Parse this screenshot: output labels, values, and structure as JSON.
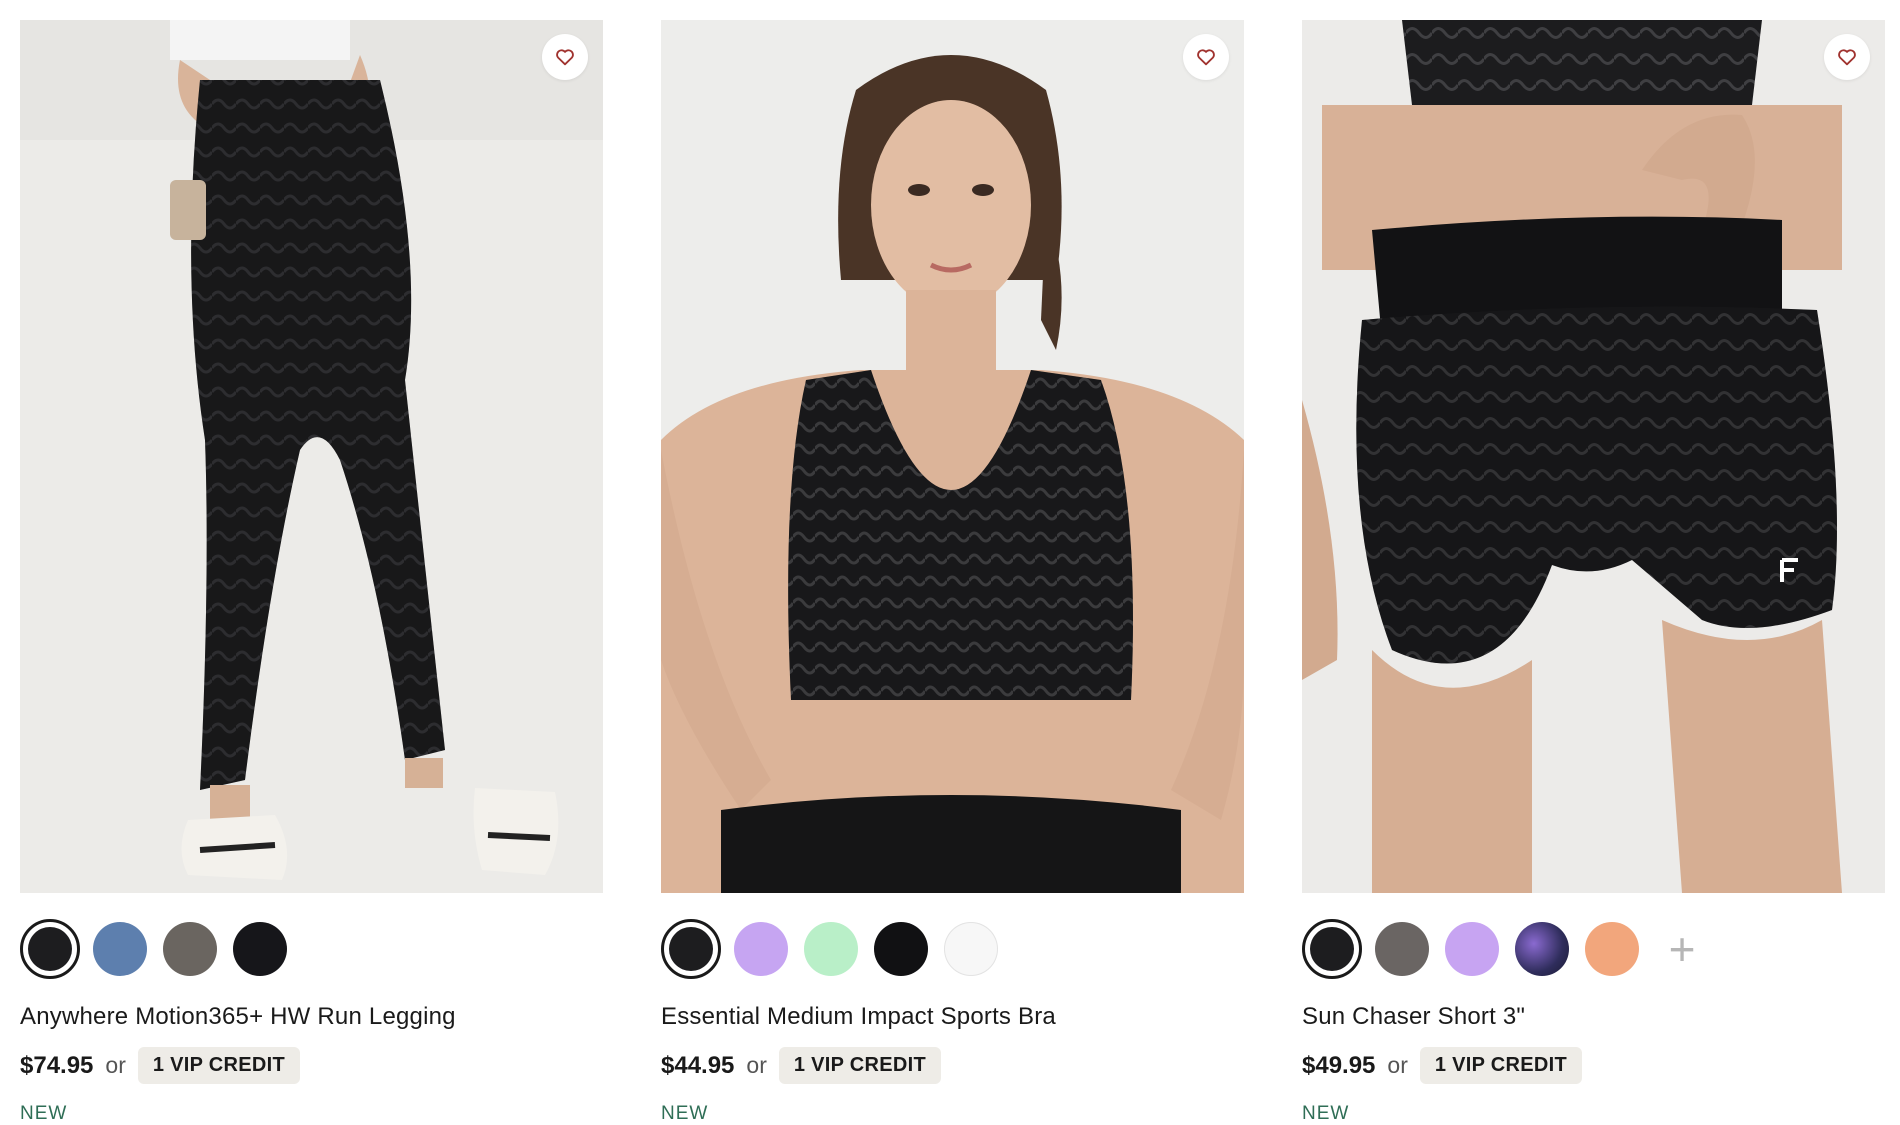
{
  "products": [
    {
      "name": "Anywhere Motion365+ HW Run Legging",
      "price": "$74.95",
      "or": "or",
      "vip": "1 VIP CREDIT",
      "badge": "NEW",
      "swatches": [
        "#1d1d1f",
        "#5d7fae",
        "#6a6560",
        "#16161a"
      ],
      "selected_swatch": 0,
      "image": "black-printed-run-legging-back-view"
    },
    {
      "name": "Essential Medium Impact Sports Bra",
      "price": "$44.95",
      "or": "or",
      "vip": "1 VIP CREDIT",
      "badge": "NEW",
      "swatches": [
        "#1d1d1f",
        "#c6a5f2",
        "#b9efc8",
        "#111113",
        "#f7f7f7"
      ],
      "selected_swatch": 0,
      "image": "black-printed-sports-bra-front-view"
    },
    {
      "name": "Sun Chaser Short 3\"",
      "price": "$49.95",
      "or": "or",
      "vip": "1 VIP CREDIT",
      "badge": "NEW",
      "swatches": [
        "#1d1d1f",
        "#6a6563",
        "#c7a4f2",
        "#2f2d5c",
        "#f2a67c"
      ],
      "selected_swatch": 0,
      "more_swatches": "+",
      "image": "black-printed-running-short-front-view"
    }
  ],
  "icons": {
    "favorite": "heart-outline-icon",
    "more_colors": "plus-icon"
  },
  "colors": {
    "heart": "#a0322e",
    "badge": "#2f6e56",
    "vip_bg": "#eeece7"
  }
}
